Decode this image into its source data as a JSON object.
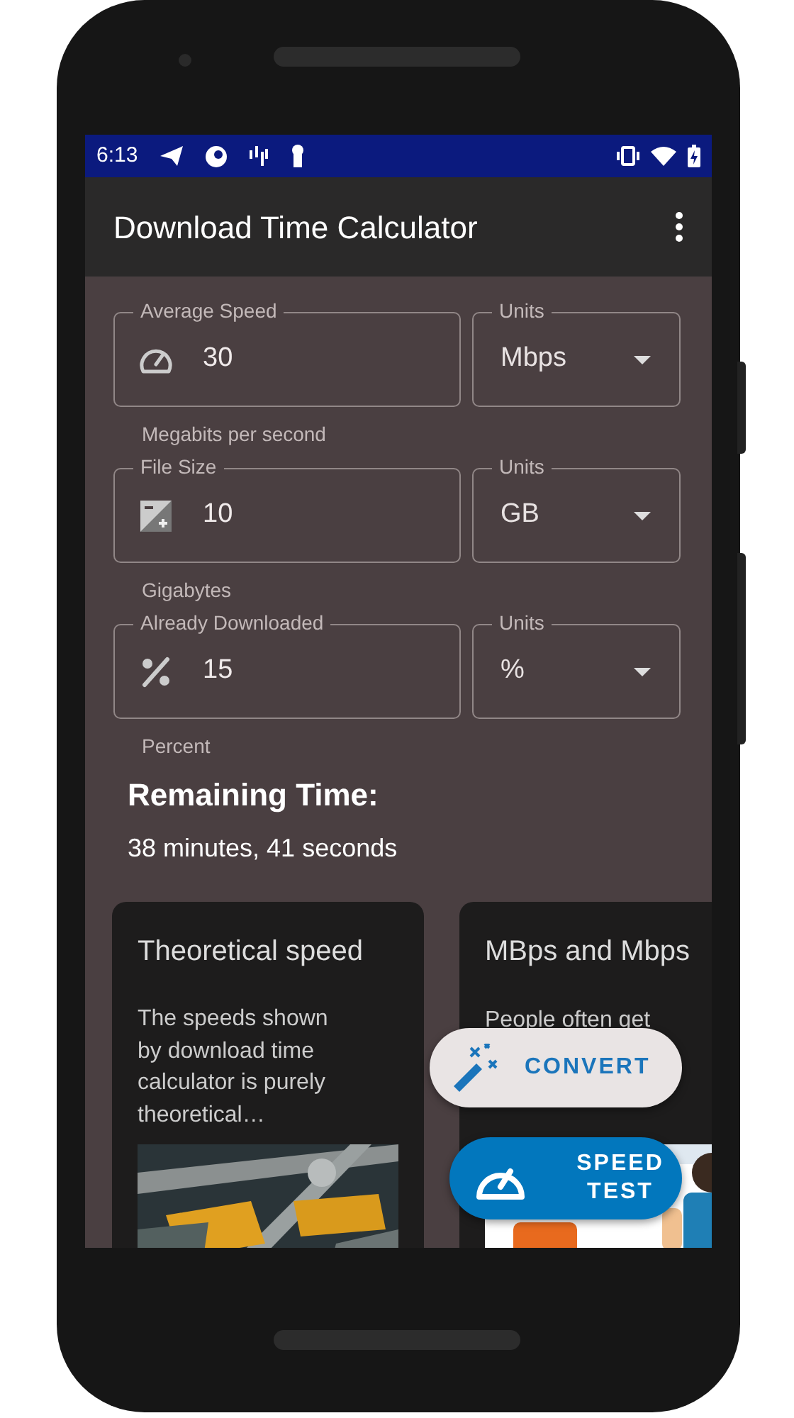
{
  "status_bar": {
    "time": "6:13"
  },
  "app_bar": {
    "title": "Download Time Calculator"
  },
  "inputs": [
    {
      "label": "Average Speed",
      "value": "30",
      "units_label": "Units",
      "units": "Mbps",
      "helper": "Megabits per second"
    },
    {
      "label": "File Size",
      "value": "10",
      "units_label": "Units",
      "units": "GB",
      "helper": "Gigabytes"
    },
    {
      "label": "Already Downloaded",
      "value": "15",
      "units_label": "Units",
      "units": "%",
      "helper": "Percent"
    }
  ],
  "result": {
    "title": "Remaining Time:",
    "value": "38 minutes, 41 seconds"
  },
  "cards": [
    {
      "title": "Theoretical speed",
      "text": "The speeds shown by download time calculator is purely theoretical…"
    },
    {
      "title": "MBps and Mbps",
      "text": "People often get"
    }
  ],
  "fabs": [
    {
      "kind": "light",
      "label": "CONVERT"
    },
    {
      "kind": "primary",
      "label": "SPEED TEST"
    }
  ]
}
